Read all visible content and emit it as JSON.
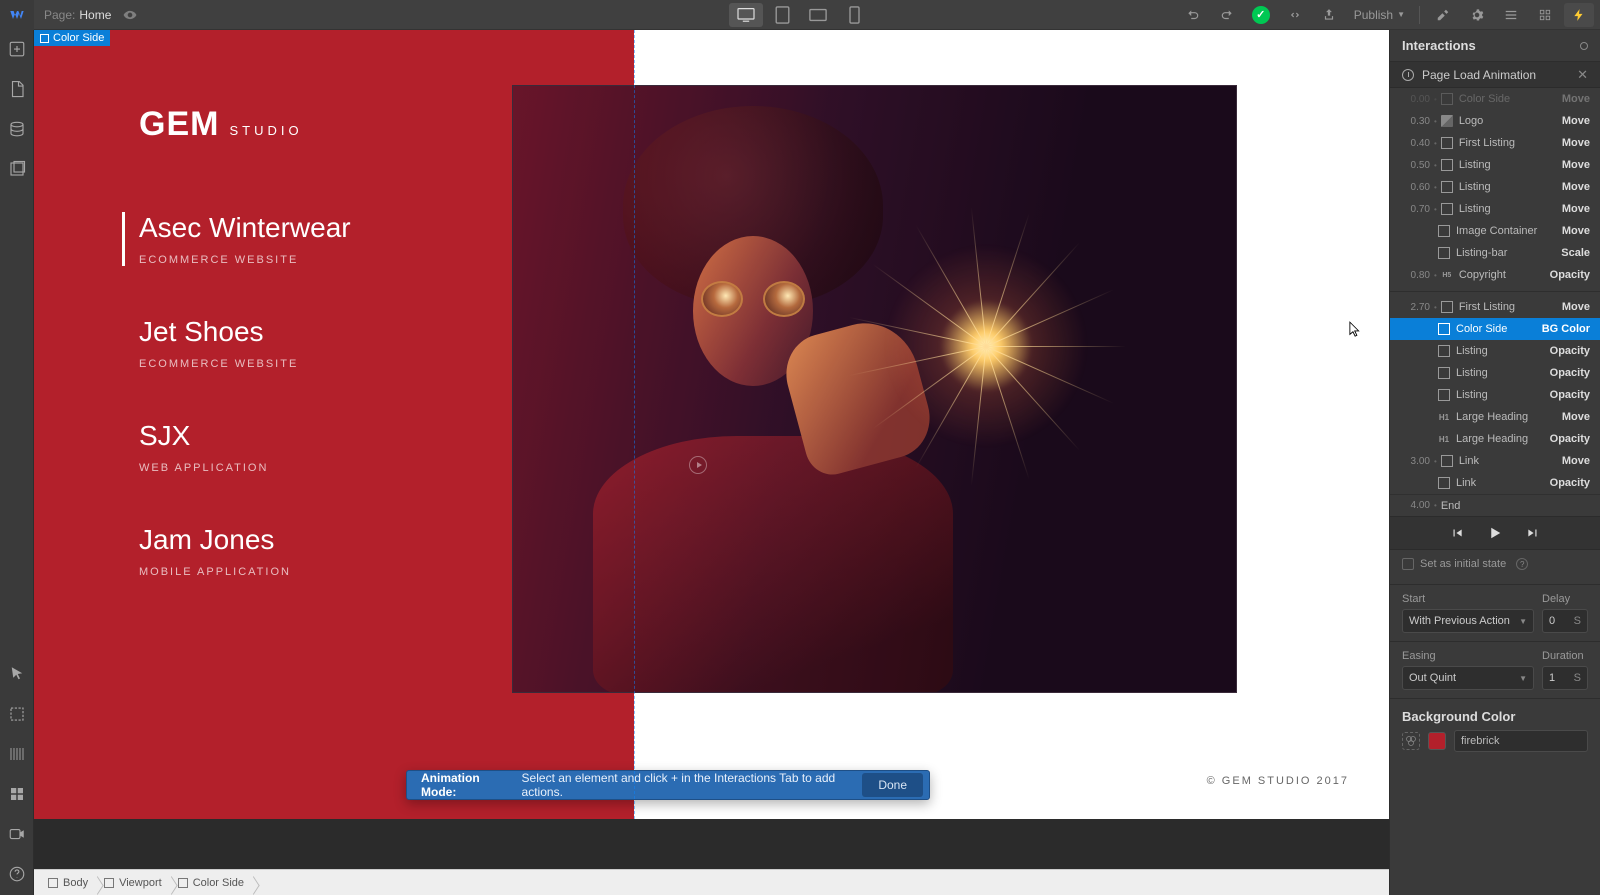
{
  "topbar": {
    "page_label": "Page:",
    "page_name": "Home",
    "publish": "Publish"
  },
  "selection_tag": "Color Side",
  "canvas": {
    "logo_main": "GEM",
    "logo_sub": "STUDIO",
    "listings": [
      {
        "title": "Asec Winterwear",
        "sub": "ECOMMERCE WEBSITE",
        "first": true
      },
      {
        "title": "Jet Shoes",
        "sub": "ECOMMERCE WEBSITE",
        "first": false
      },
      {
        "title": "SJX",
        "sub": "WEB APPLICATION",
        "first": false
      },
      {
        "title": "Jam Jones",
        "sub": "MOBILE APPLICATION",
        "first": false
      }
    ],
    "copyright": "© GEM STUDIO 2017"
  },
  "notice": {
    "title": "Animation Mode:",
    "body": "Select an element and click + in the Interactions Tab to add actions.",
    "done": "Done"
  },
  "panel": {
    "title": "Interactions",
    "trigger": "Page Load Animation",
    "timeline": [
      {
        "time": "0.00",
        "dim": true,
        "icon": "sq",
        "name": "Color Side",
        "action": "Move"
      },
      {
        "time": "0.30",
        "icon": "img",
        "name": "Logo",
        "action": "Move"
      },
      {
        "time": "0.40",
        "icon": "sq",
        "name": "First Listing",
        "action": "Move"
      },
      {
        "time": "0.50",
        "icon": "sq",
        "name": "Listing",
        "action": "Move"
      },
      {
        "time": "0.60",
        "icon": "sq",
        "name": "Listing",
        "action": "Move"
      },
      {
        "time": "0.70",
        "icon": "sq",
        "name": "Listing",
        "action": "Move"
      },
      {
        "time": "",
        "icon": "sq",
        "name": "Image Container",
        "action": "Move"
      },
      {
        "time": "",
        "icon": "sq",
        "name": "Listing-bar",
        "action": "Scale"
      },
      {
        "time": "0.80",
        "icon": "h5",
        "name": "Copyright",
        "action": "Opacity"
      },
      {
        "divider": true
      },
      {
        "time": "2.70",
        "icon": "sq",
        "name": "First Listing",
        "action": "Move"
      },
      {
        "time": "",
        "sel": true,
        "icon": "sq",
        "name": "Color Side",
        "action": "BG Color"
      },
      {
        "time": "",
        "icon": "sq",
        "name": "Listing",
        "action": "Opacity"
      },
      {
        "time": "",
        "icon": "sq",
        "name": "Listing",
        "action": "Opacity"
      },
      {
        "time": "",
        "icon": "sq",
        "name": "Listing",
        "action": "Opacity"
      },
      {
        "time": "",
        "icon": "h1",
        "name": "Large Heading",
        "action": "Move"
      },
      {
        "time": "",
        "icon": "h1",
        "name": "Large Heading",
        "action": "Opacity"
      },
      {
        "time": "3.00",
        "icon": "sq",
        "name": "Link",
        "action": "Move"
      },
      {
        "time": "",
        "icon": "sq",
        "name": "Link",
        "action": "Opacity"
      }
    ],
    "end_time": "4.00",
    "end_label": "End",
    "initial_state": "Set as initial state",
    "props": {
      "start_label": "Start",
      "delay_label": "Delay",
      "start_value": "With Previous Action",
      "delay_value": "0",
      "delay_unit": "S",
      "easing_label": "Easing",
      "duration_label": "Duration",
      "easing_value": "Out Quint",
      "duration_value": "1",
      "duration_unit": "S"
    },
    "bgcolor": {
      "heading": "Background Color",
      "value": "firebrick"
    }
  },
  "breadcrumb": [
    {
      "label": "Body"
    },
    {
      "label": "Viewport"
    },
    {
      "label": "Color Side"
    }
  ]
}
